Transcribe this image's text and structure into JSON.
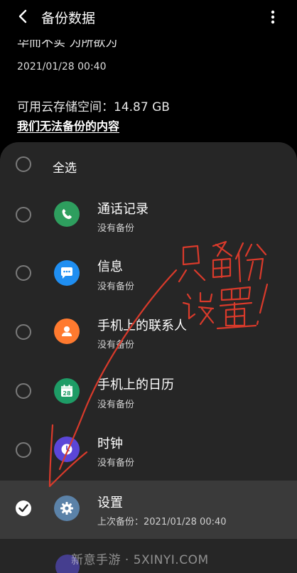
{
  "header": {
    "title": "备份数据",
    "back_icon": "chevron-left-icon",
    "more_icon": "more-vertical-icon"
  },
  "backup_info": {
    "device_name": "华而不实 为所欲为",
    "date": "2021/01/28 00:40",
    "storage": "可用云存储空间：14.87 GB",
    "cannot_backup_link": "我们无法备份的内容"
  },
  "sheet": {
    "select_all_label": "全选",
    "items": [
      {
        "title": "通话记录",
        "status": "没有备份",
        "icon": "phone-icon",
        "color": "#2e9e5e",
        "checked": false
      },
      {
        "title": "信息",
        "status": "没有备份",
        "icon": "message-icon",
        "color": "#1f8ef1",
        "checked": false
      },
      {
        "title": "手机上的联系人",
        "status": "没有备份",
        "icon": "contact-icon",
        "color": "#ff7a2f",
        "checked": false
      },
      {
        "title": "手机上的日历",
        "status": "没有备份",
        "icon": "calendar-icon",
        "color": "#1e9c66",
        "calendar_day": "28",
        "checked": false
      },
      {
        "title": "时钟",
        "status": "没有备份",
        "icon": "clock-icon",
        "color": "#5b46d8",
        "checked": false
      },
      {
        "title": "设置",
        "status": "上次备份：2021/01/28 00:40",
        "icon": "gear-icon",
        "color": "#5b82a8",
        "checked": true
      }
    ]
  },
  "annotation": {
    "handwriting": "只备份设置！",
    "color": "#d93a2b"
  },
  "watermark": "新意手游 · 5XINYI.COM"
}
